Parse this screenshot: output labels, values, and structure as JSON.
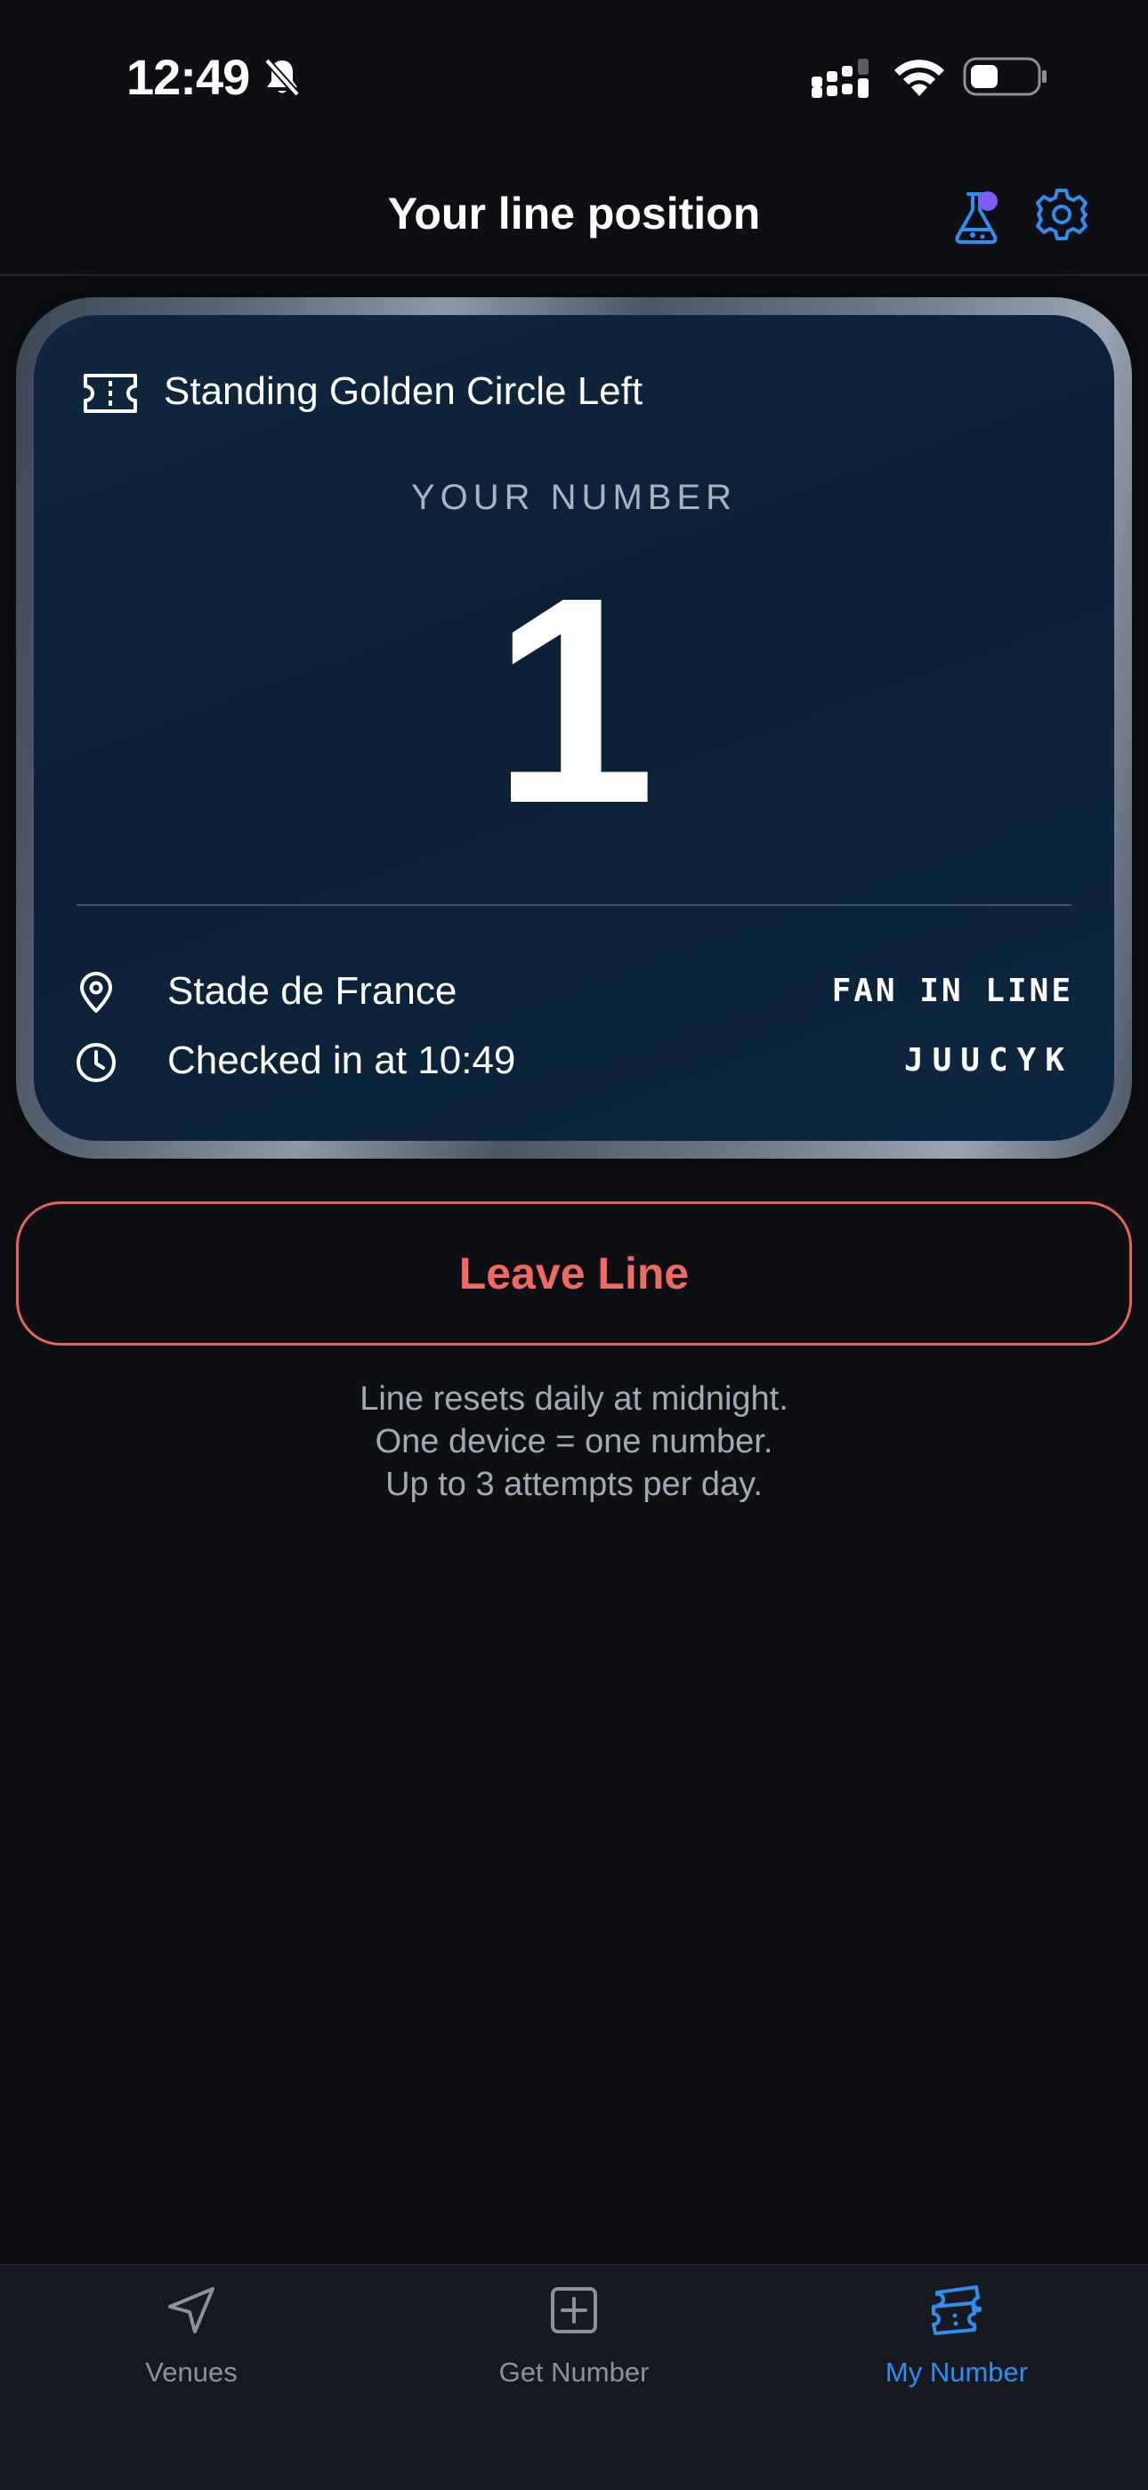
{
  "status_bar": {
    "time": "12:49"
  },
  "header": {
    "title": "Your line position"
  },
  "card": {
    "zone": "Standing Golden Circle Left",
    "number_label": "YOUR NUMBER",
    "number": "1",
    "venue": "Stade de France",
    "checkin": "Checked in at 10:49",
    "tag": "FAN IN LINE",
    "code": "JUUCYK"
  },
  "actions": {
    "leave_label": "Leave Line"
  },
  "info": {
    "line1": "Line resets daily at midnight.",
    "line2": "One device = one number.",
    "line3": "Up to 3 attempts per day."
  },
  "tabs": [
    {
      "label": "Venues",
      "icon": "navigation-arrow-icon"
    },
    {
      "label": "Get Number",
      "icon": "plus-square-icon"
    },
    {
      "label": "My Number",
      "icon": "ticket-icon"
    }
  ],
  "colors": {
    "background": "#0e0f13",
    "accent": "#2f8ef0",
    "danger": "#ee6a64",
    "card": "#0c2035",
    "badge": "#7b5cf5"
  }
}
